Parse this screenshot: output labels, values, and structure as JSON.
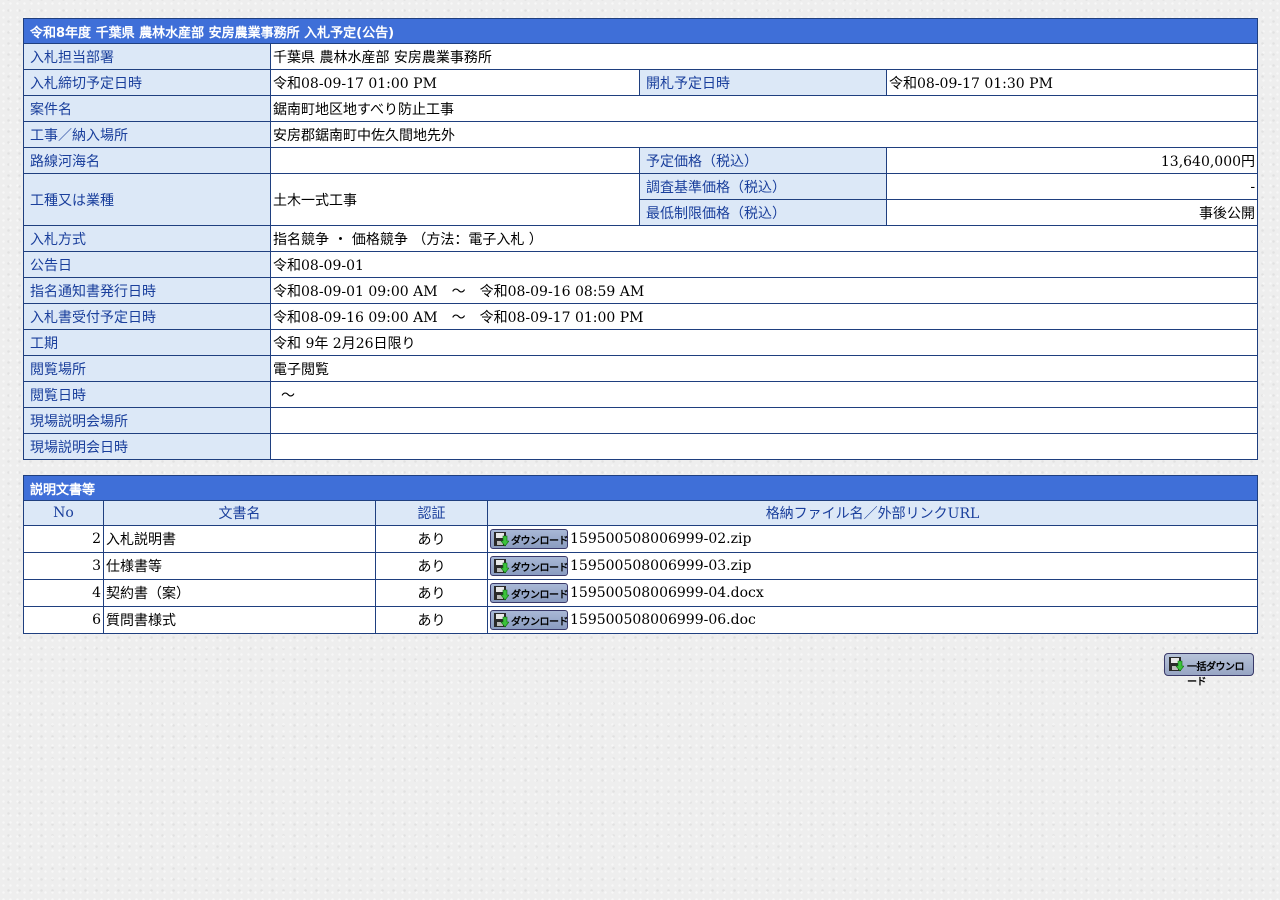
{
  "info": {
    "title": "令和8年度 千葉県 農林水産部 安房農業事務所 入札予定(公告)",
    "department_label": "入札担当部署",
    "department_value": "千葉県 農林水産部 安房農業事務所",
    "deadline_label": "入札締切予定日時",
    "deadline_value": "令和08-09-17 01:00 PM",
    "opening_label": "開札予定日時",
    "opening_value": "令和08-09-17 01:30 PM",
    "case_label": "案件名",
    "case_value": "鋸南町地区地すべり防止工事",
    "location_label": "工事／納入場所",
    "location_value": "安房郡鋸南町中佐久間地先外",
    "route_label": "路線河海名",
    "route_value": "",
    "planned_price_label": "予定価格（税込）",
    "planned_price_value": "13,640,000円",
    "work_type_label": "工種又は業種",
    "work_type_value": "土木一式工事",
    "survey_price_label": "調査基準価格（税込）",
    "survey_price_value": "-",
    "min_price_label": "最低制限価格（税込）",
    "min_price_value": "事後公開",
    "method_label": "入札方式",
    "method_value": "指名競争 ・ 価格競争 （方法：電子入札 ）",
    "announce_label": "公告日",
    "announce_value": "令和08-09-01",
    "notice_label": "指名通知書発行日時",
    "notice_value": "令和08-09-01 09:00 AM　～　令和08-09-16 08:59 AM",
    "receipt_label": "入札書受付予定日時",
    "receipt_value": "令和08-09-16 09:00 AM　～　令和08-09-17 01:00 PM",
    "period_label": "工期",
    "period_value": "令和 9年 2月26日限り",
    "viewing_place_label": "閲覧場所",
    "viewing_place_value": "電子閲覧",
    "viewing_date_label": "閲覧日時",
    "viewing_date_value": "～",
    "briefing_place_label": "現場説明会場所",
    "briefing_place_value": "",
    "briefing_date_label": "現場説明会日時",
    "briefing_date_value": ""
  },
  "documents": {
    "title": "説明文書等",
    "headers": {
      "no": "No",
      "name": "文書名",
      "auth": "認証",
      "file": "格納ファイル名／外部リンクURL"
    },
    "download_label": "ダウンロード",
    "rows": [
      {
        "no": "2",
        "name": "入札説明書",
        "auth": "あり",
        "file": "159500508006999-02.zip"
      },
      {
        "no": "3",
        "name": "仕様書等",
        "auth": "あり",
        "file": "159500508006999-03.zip"
      },
      {
        "no": "4",
        "name": "契約書（案）",
        "auth": "あり",
        "file": "159500508006999-04.docx"
      },
      {
        "no": "6",
        "name": "質問書様式",
        "auth": "あり",
        "file": "159500508006999-06.doc"
      }
    ]
  },
  "bulk_download_label": "一括ダウンロード"
}
